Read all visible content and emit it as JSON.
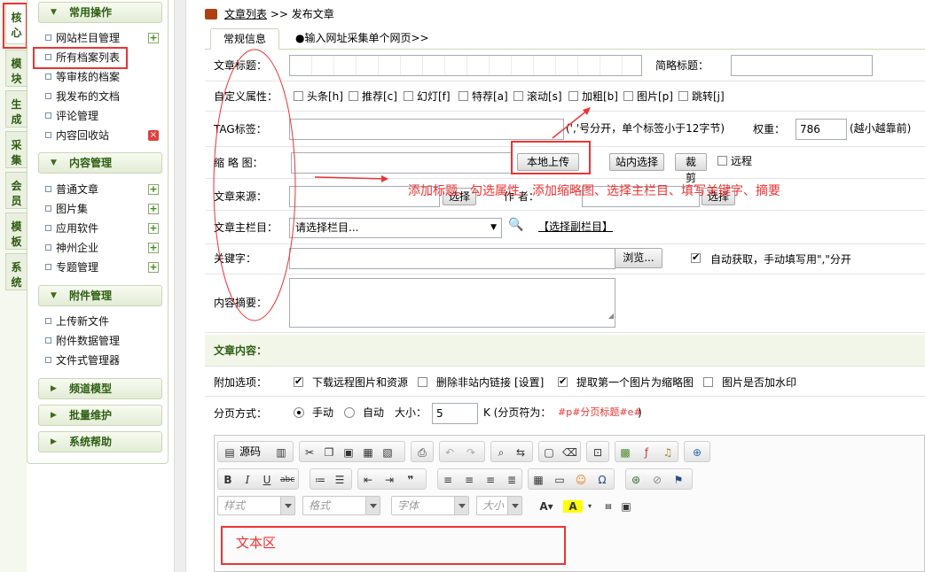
{
  "vtabs": [
    "核心",
    "模块",
    "生成",
    "采集",
    "会员",
    "模板",
    "系统"
  ],
  "sidebar": {
    "sections": {
      "common": "常用操作",
      "content": "内容管理",
      "attach": "附件管理",
      "channel": "频道模型",
      "batch": "批量维护",
      "help": "系统帮助"
    },
    "common_items": [
      "网站栏目管理",
      "所有档案列表",
      "等审核的档案",
      "我发布的文档",
      "评论管理",
      "内容回收站"
    ],
    "content_items": [
      "普通文章",
      "图片集",
      "应用软件",
      "神州企业",
      "专题管理"
    ],
    "attach_items": [
      "上传新文件",
      "附件数据管理",
      "文件式管理器"
    ]
  },
  "breadcrumb": {
    "link": "文章列表",
    "sep": ">>",
    "current": "发布文章"
  },
  "tabs": {
    "general": "常规信息",
    "collect": "●输入网址采集单个网页>>"
  },
  "form": {
    "title_label": "文章标题：",
    "short_title_label": "简略标题：",
    "attr_label": "自定义属性：",
    "attrs": [
      "头条[h]",
      "推荐[c]",
      "幻灯[f]",
      "特荐[a]",
      "滚动[s]",
      "加粗[b]",
      "图片[p]",
      "跳转[j]"
    ],
    "tag_label": "TAG标签：",
    "tag_hint": "(','号分开，单个标签小于12字节)",
    "weight_label": "权重：",
    "weight_value": "786",
    "weight_hint": "(越小越靠前)",
    "thumb_label": "缩 略 图：",
    "upload_btn": "本地上传",
    "site_select_btn": "站内选择",
    "crop_btn": "裁剪",
    "remote_label": "远程",
    "source_label": "文章来源：",
    "select_btn": "选择",
    "author_label": "作 者：",
    "author_select_btn": "选择",
    "category_label": "文章主栏目：",
    "category_value": "请选择栏目...",
    "sub_category_link": "【选择副栏目】",
    "keywords_label": "关键字：",
    "browse_btn": "浏览...",
    "auto_keyword_label": "自动获取，手动填写用\",\"分开",
    "summary_label": "内容摘要："
  },
  "annotation": "添加标题、勾选属性、添加缩略图、选择主栏目、填写关键字、摘要",
  "content": {
    "section_title": "文章内容：",
    "extra_label": "附加选项：",
    "extra_opts": [
      "下载远程图片和资源",
      "删除非站内链接",
      "[设置]",
      "提取第一个图片为缩略图",
      "图片是否加水印"
    ],
    "paging_label": "分页方式：",
    "manual": "手动",
    "auto": "自动",
    "size_label": "大小：",
    "size_value": "5",
    "size_unit": "K (分页符为：",
    "page_tag": "#p#分页标题#e#",
    "paren_close": ")"
  },
  "editor": {
    "source_label": "源码",
    "style_combo": "样式",
    "format_combo": "格式",
    "font_combo": "字体",
    "size_combo": "大小",
    "text_area_label": "文本区"
  },
  "colors": {
    "accent": "#2e5f13",
    "annotation": "#e33333"
  }
}
